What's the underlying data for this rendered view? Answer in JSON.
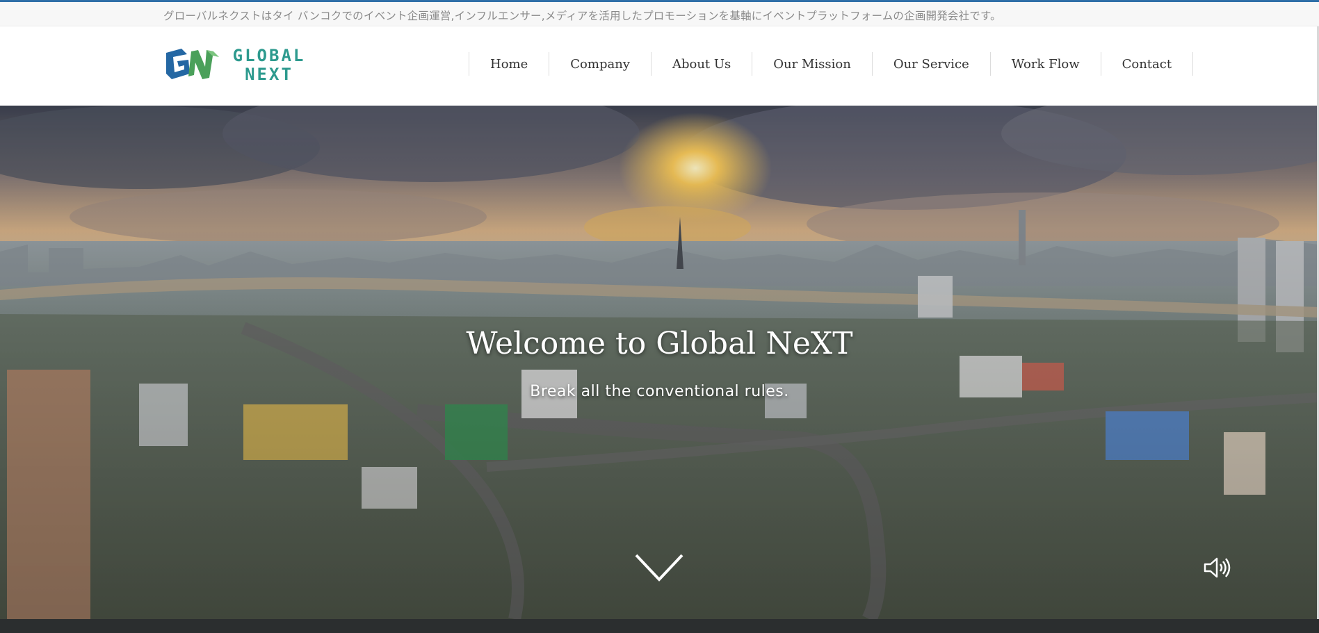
{
  "tagline": "グローバルネクストはタイ バンコクでのイベント企画運営,インフルエンサー,メディアを活用したプロモーションを基軸にイベントプラットフォームの企画開発会社です。",
  "logo": {
    "line1": "GLOBAL",
    "line2": "NEXT",
    "mark_icon": "global-next-logo-mark",
    "colors": {
      "blue": "#2467a3",
      "green": "#4aa05a",
      "teal": "#2d9a8e"
    }
  },
  "nav": {
    "items": [
      "Home",
      "Company",
      "About Us",
      "Our Mission",
      "Our Service",
      "Work Flow",
      "Contact"
    ]
  },
  "hero": {
    "title": "Welcome to Global NeXT",
    "subtitle": "Break all the conventional rules.",
    "scroll_icon": "chevron-down-icon",
    "sound_icon": "speaker-icon"
  }
}
